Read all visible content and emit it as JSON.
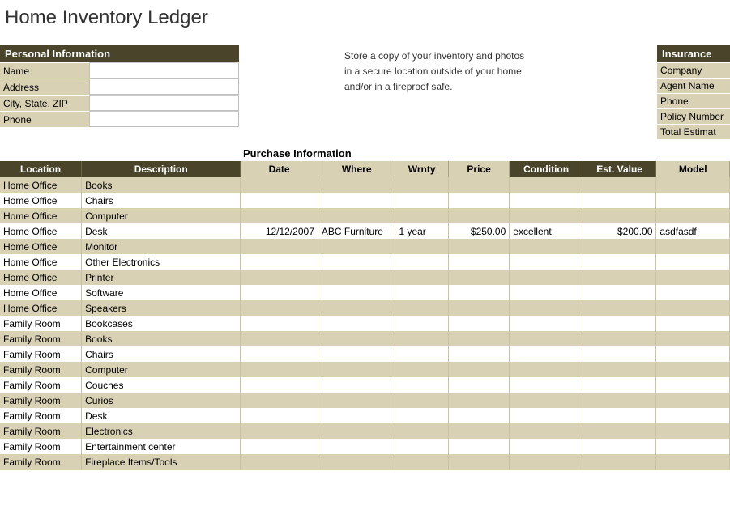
{
  "title": "Home Inventory Ledger",
  "personal": {
    "header": "Personal Information",
    "fields": {
      "name": {
        "label": "Name",
        "value": ""
      },
      "address": {
        "label": "Address",
        "value": ""
      },
      "csz": {
        "label": "City, State, ZIP",
        "value": ""
      },
      "phone": {
        "label": "Phone",
        "value": ""
      }
    }
  },
  "note": {
    "line1": "Store a copy of your inventory and photos",
    "line2": "in a secure location outside of your home",
    "line3": "and/or in a fireproof safe."
  },
  "insurance": {
    "header": "Insurance",
    "rows": [
      "Company",
      "Agent Name",
      "Phone",
      "Policy Number",
      "Total Estimat"
    ]
  },
  "purchase_section_title": "Purchase Information",
  "columns": {
    "location": "Location",
    "description": "Description",
    "date": "Date",
    "where": "Where",
    "wrnty": "Wrnty",
    "price": "Price",
    "condition": "Condition",
    "est_value": "Est. Value",
    "model": "Model"
  },
  "rows": [
    {
      "location": "Home Office",
      "description": "Books"
    },
    {
      "location": "Home Office",
      "description": "Chairs"
    },
    {
      "location": "Home Office",
      "description": "Computer"
    },
    {
      "location": "Home Office",
      "description": "Desk",
      "date": "12/12/2007",
      "where": "ABC Furniture",
      "wrnty": "1 year",
      "price": "$250.00",
      "condition": "excellent",
      "est_value": "$200.00",
      "model": "asdfasdf"
    },
    {
      "location": "Home Office",
      "description": "Monitor"
    },
    {
      "location": "Home Office",
      "description": "Other Electronics"
    },
    {
      "location": "Home Office",
      "description": "Printer"
    },
    {
      "location": "Home Office",
      "description": "Software"
    },
    {
      "location": "Home Office",
      "description": "Speakers"
    },
    {
      "location": "Family Room",
      "description": "Bookcases"
    },
    {
      "location": "Family Room",
      "description": "Books"
    },
    {
      "location": "Family Room",
      "description": "Chairs"
    },
    {
      "location": "Family Room",
      "description": "Computer"
    },
    {
      "location": "Family Room",
      "description": "Couches"
    },
    {
      "location": "Family Room",
      "description": "Curios"
    },
    {
      "location": "Family Room",
      "description": "Desk"
    },
    {
      "location": "Family Room",
      "description": "Electronics"
    },
    {
      "location": "Family Room",
      "description": "Entertainment center"
    },
    {
      "location": "Family Room",
      "description": "Fireplace Items/Tools"
    }
  ]
}
